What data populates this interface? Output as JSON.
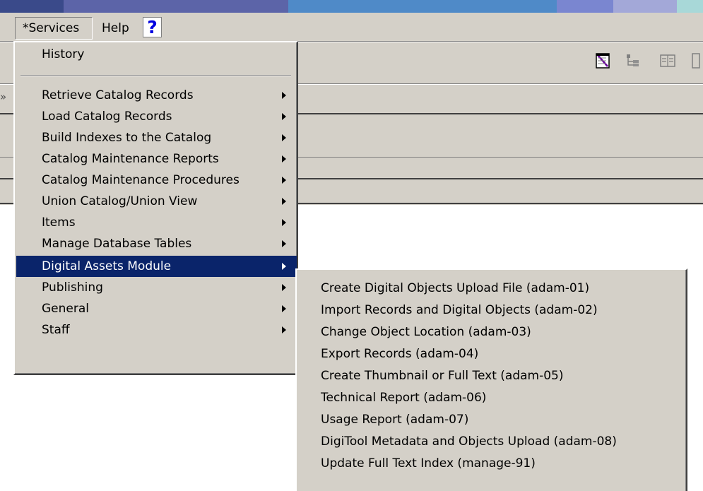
{
  "colors": {
    "face": "#d4d0c8",
    "highlight": "#0a246a",
    "title_strip": [
      "#3a4a8a",
      "#5a6fc0",
      "#4f80c8",
      "#7a9ad8",
      "#a6b0d8",
      "#b8c7e0"
    ]
  },
  "menubar": {
    "services_label": "*Services",
    "help_label": "Help",
    "help_button_glyph": "?"
  },
  "toolbar": {
    "icons": [
      "notepad-icon",
      "tree-view-icon",
      "columns-icon",
      "book-icon"
    ],
    "left_stub_glyph": "»"
  },
  "services_menu": {
    "items": [
      {
        "label": "History",
        "has_submenu": false
      },
      {
        "label": "Retrieve Catalog Records",
        "has_submenu": true
      },
      {
        "label": "Load Catalog Records",
        "has_submenu": true
      },
      {
        "label": "Build Indexes to the Catalog",
        "has_submenu": true
      },
      {
        "label": "Catalog Maintenance Reports",
        "has_submenu": true
      },
      {
        "label": "Catalog Maintenance Procedures",
        "has_submenu": true
      },
      {
        "label": "Union Catalog/Union View",
        "has_submenu": true
      },
      {
        "label": "Items",
        "has_submenu": true
      },
      {
        "label": "Manage Database Tables",
        "has_submenu": true
      },
      {
        "label": "Digital Assets Module",
        "has_submenu": true,
        "active": true
      },
      {
        "label": "Publishing",
        "has_submenu": true
      },
      {
        "label": "General",
        "has_submenu": true
      },
      {
        "label": "Staff",
        "has_submenu": true
      }
    ]
  },
  "digital_assets_submenu": {
    "items": [
      {
        "label": "Create Digital Objects Upload File (adam-01)"
      },
      {
        "label": "Import Records and Digital Objects (adam-02)"
      },
      {
        "label": "Change Object Location (adam-03)"
      },
      {
        "label": "Export Records (adam-04)"
      },
      {
        "label": "Create Thumbnail or Full Text (adam-05)"
      },
      {
        "label": "Technical Report (adam-06)"
      },
      {
        "label": "Usage Report (adam-07)"
      },
      {
        "label": "DigiTool Metadata and Objects Upload (adam-08)"
      },
      {
        "label": "Update Full Text Index (manage-91)"
      }
    ]
  }
}
